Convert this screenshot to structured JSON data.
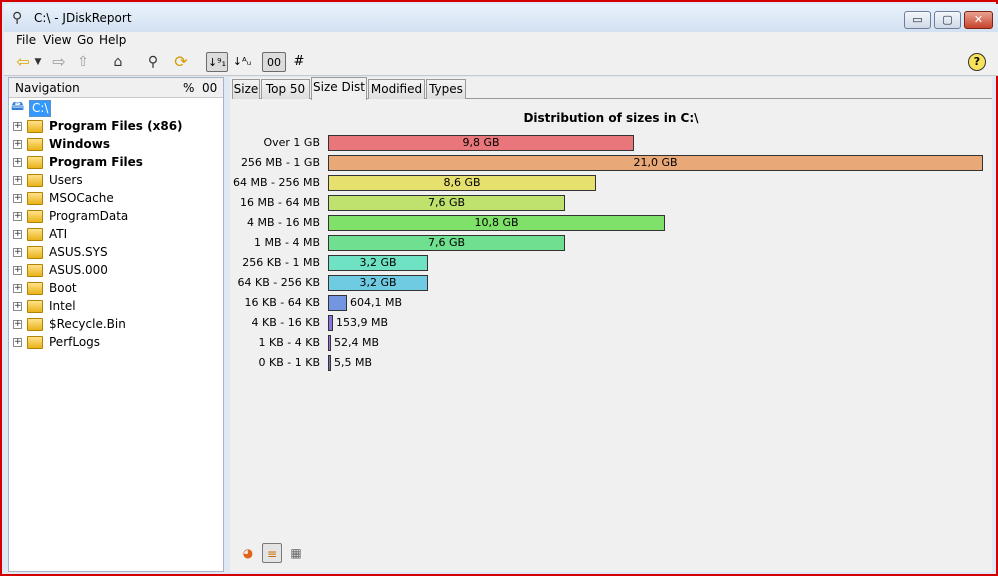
{
  "window": {
    "title": "C:\\ - JDiskReport",
    "app_icon": "magnifier-app-icon",
    "controls": {
      "minimize": "▭",
      "maximize": "▢",
      "close": "✕"
    }
  },
  "menu": [
    "File",
    "View",
    "Go",
    "Help"
  ],
  "toolbar": {
    "back": "⇦",
    "back_dropdown": "▼",
    "forward": "⇨",
    "up": "⇧",
    "home": "⌂",
    "search": "⚲",
    "refresh": "⟳",
    "sort_size": "↓⁹₁",
    "sort_name": "↓ᴬᵤ",
    "percent_mode": "00",
    "count_mode": "#",
    "help": "?"
  },
  "navigation": {
    "header": "Navigation",
    "pct_col": "%",
    "size_col": "00",
    "root": "C:\\",
    "expander_glyph": "+",
    "items": [
      {
        "label": "Program Files (x86)",
        "bold": true
      },
      {
        "label": "Windows",
        "bold": true
      },
      {
        "label": "Program Files",
        "bold": true
      },
      {
        "label": "Users",
        "bold": false
      },
      {
        "label": "MSOCache",
        "bold": false
      },
      {
        "label": "ProgramData",
        "bold": false
      },
      {
        "label": "ATI",
        "bold": false
      },
      {
        "label": "ASUS.SYS",
        "bold": false
      },
      {
        "label": "ASUS.000",
        "bold": false
      },
      {
        "label": "Boot",
        "bold": false
      },
      {
        "label": "Intel",
        "bold": false
      },
      {
        "label": "$Recycle.Bin",
        "bold": false
      },
      {
        "label": "PerfLogs",
        "bold": false
      }
    ]
  },
  "tabs": [
    {
      "label": "Size",
      "active": false
    },
    {
      "label": "Top 50",
      "active": false
    },
    {
      "label": "Size Dist",
      "active": true
    },
    {
      "label": "Modified",
      "active": false
    },
    {
      "label": "Types",
      "active": false
    }
  ],
  "view_toggles": {
    "pie": "◕",
    "bar": "≡",
    "table": "▦"
  },
  "chart_data": {
    "type": "bar",
    "orientation": "horizontal",
    "title": "Distribution of sizes in C:\\",
    "unit": "GB",
    "categories": [
      "Over 1 GB",
      "256 MB - 1 GB",
      "64 MB - 256 MB",
      "16 MB - 64 MB",
      "4 MB - 16 MB",
      "1 MB - 4 MB",
      "256 KB - 1 MB",
      "64 KB - 256 KB",
      "16 KB - 64 KB",
      "4 KB - 16 KB",
      "1 KB - 4 KB",
      "0 KB - 1 KB"
    ],
    "values": [
      9.8,
      21.0,
      8.6,
      7.6,
      10.8,
      7.6,
      3.2,
      3.2,
      0.6041,
      0.1539,
      0.0524,
      0.0055
    ],
    "labels": [
      "9,8 GB",
      "21,0 GB",
      "8,6 GB",
      "7,6 GB",
      "10,8 GB",
      "7,6 GB",
      "3,2 GB",
      "3,2 GB",
      "604,1 MB",
      "153,9 MB",
      "52,4 MB",
      "5,5 MB"
    ],
    "colors": [
      "#e8767a",
      "#e8a878",
      "#e6e06e",
      "#bfe26f",
      "#7fe06a",
      "#6fe08f",
      "#6fe2c4",
      "#6fcbe2",
      "#7296e2",
      "#8c72e2",
      "#a272e2",
      "#7a72b2"
    ],
    "xlim": [
      0,
      21.0
    ]
  }
}
